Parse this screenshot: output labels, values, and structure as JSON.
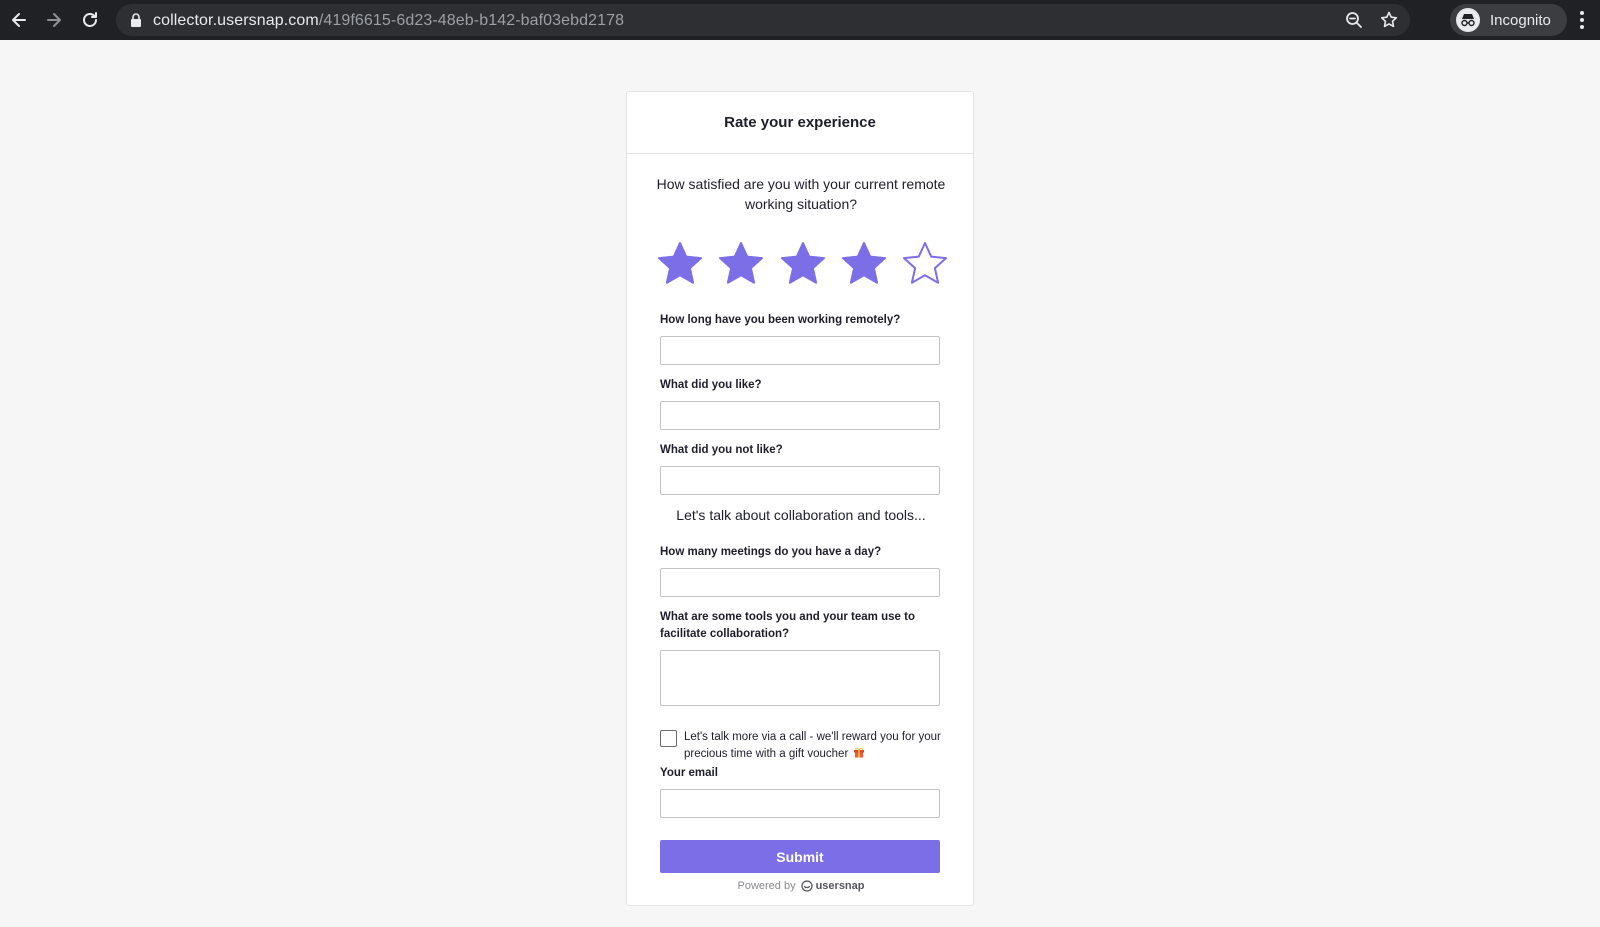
{
  "browser": {
    "url_domain": "collector.usersnap.com",
    "url_path": "/419f6615-6d23-48eb-b142-baf03ebd2178",
    "profile_label": "Incognito"
  },
  "survey": {
    "title": "Rate your experience",
    "question": "How satisfied are you with your current remote working situation?",
    "rating": {
      "value": 4,
      "max": 5,
      "accent_color": "#7b6ee6"
    },
    "fields": [
      {
        "label": "How long have you been working remotely?",
        "value": ""
      },
      {
        "label": "What did you like?",
        "value": ""
      },
      {
        "label": "What did you not like?",
        "value": ""
      }
    ],
    "section_heading": "Let's talk about collaboration and tools...",
    "fields2": [
      {
        "label": "How many meetings do you have a day?",
        "value": ""
      },
      {
        "label": "What are some tools you and your team use to facilitate collaboration?",
        "value": ""
      }
    ],
    "checkbox": {
      "label": "Let's talk more via a call - we'll reward you for your precious time with a gift voucher",
      "checked": false
    },
    "email": {
      "label": "Your email",
      "value": ""
    },
    "submit_label": "Submit",
    "powered_by": "Powered by",
    "brand": "usersnap"
  }
}
